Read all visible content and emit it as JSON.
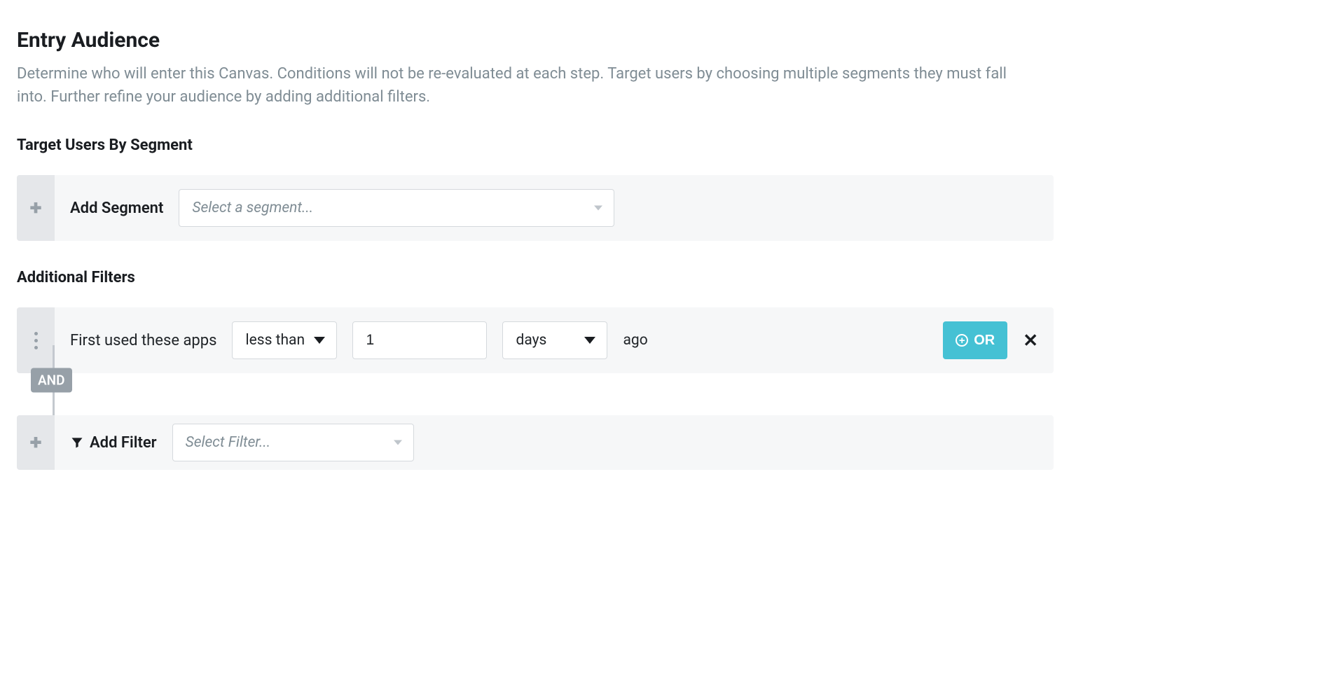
{
  "header": {
    "title": "Entry Audience",
    "description": "Determine who will enter this Canvas. Conditions will not be re-evaluated at each step. Target users by choosing multiple segments they must fall into. Further refine your audience by adding additional filters."
  },
  "segments": {
    "section_title": "Target Users By Segment",
    "add_label": "Add Segment",
    "select_placeholder": "Select a segment..."
  },
  "filters": {
    "section_title": "Additional Filters",
    "rows": [
      {
        "field_label": "First used these apps",
        "operator": "less than",
        "value": "1",
        "unit": "days",
        "suffix": "ago"
      }
    ],
    "connector_label": "AND",
    "or_button": "OR",
    "add_filter_label": "Add Filter",
    "add_filter_placeholder": "Select Filter..."
  }
}
